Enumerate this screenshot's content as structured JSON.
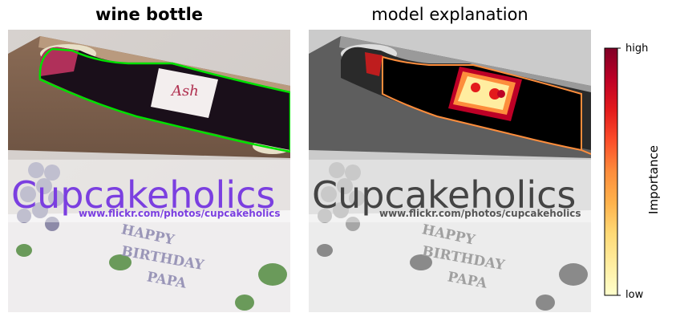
{
  "left_panel": {
    "title": "wine bottle",
    "watermark": "Cupcakeholics",
    "url": "www.flickr.com/photos/cupcakeholics",
    "cake_text": [
      "HAPPY",
      "BIRTHDAY",
      "PAPA"
    ],
    "label_script": "Ash"
  },
  "right_panel": {
    "title": "model explanation",
    "watermark": "Cupcakeholics",
    "url": "www.flickr.com/photos/cupcakeholics",
    "cake_text": [
      "HAPPY",
      "BIRTHDAY",
      "PAPA"
    ]
  },
  "colorbar": {
    "label": "Importance",
    "high": "high",
    "low": "low",
    "colors": [
      "#ffffcc",
      "#ffeda0",
      "#fed976",
      "#feb24c",
      "#fd8d3c",
      "#fc4e2a",
      "#e31a1c",
      "#bd0026",
      "#800026"
    ]
  },
  "colors": {
    "outline": "#00e000",
    "watermark_left": "#7b3fe0",
    "watermark_right": "#444444"
  }
}
